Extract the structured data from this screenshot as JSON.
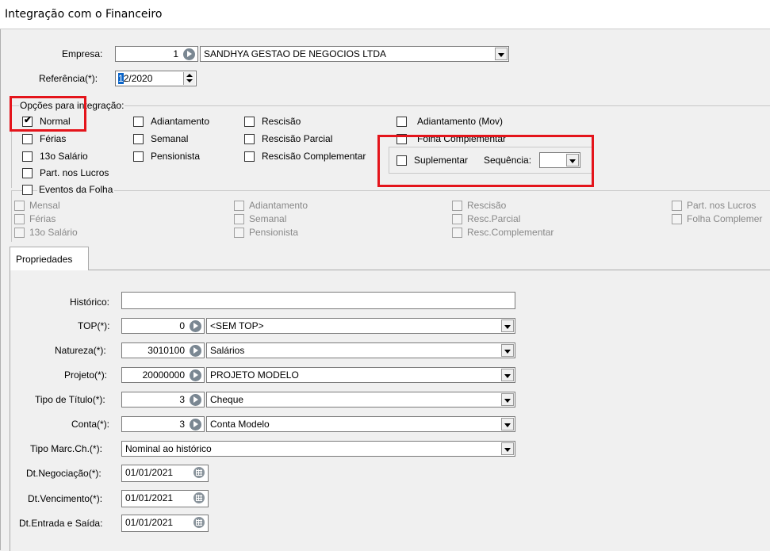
{
  "window": {
    "title": "Integração com o Financeiro"
  },
  "empresa": {
    "label": "Empresa:",
    "code": "1",
    "name": "SANDHYA GESTAO DE NEGOCIOS LTDA"
  },
  "referencia": {
    "label": "Referência(*):",
    "value_first": "1",
    "value_rest": "2/2020"
  },
  "opcoes": {
    "label": "Opções para integração:",
    "normal": {
      "label": "Normal",
      "checked": true
    },
    "ferias": "Férias",
    "salario13": "13o Salário",
    "lucros": "Part. nos Lucros",
    "adiantamento": "Adiantamento",
    "semanal": "Semanal",
    "pensionista": "Pensionista",
    "rescisao": "Rescisão",
    "rescisao_parcial": "Rescisão Parcial",
    "rescisao_complementar": "Rescisão Complementar",
    "adiantamento_mov": "Adiantamento (Mov)",
    "folha_complementar": "Folha Complementar",
    "suplementar": "Suplementar",
    "sequencia": "Sequência:"
  },
  "eventos": {
    "label": "Eventos da Folha",
    "mensal": "Mensal",
    "ferias": "Férias",
    "salario13": "13o Salário",
    "adiantamento": "Adiantamento",
    "semanal": "Semanal",
    "pensionista": "Pensionista",
    "rescisao": "Rescisão",
    "resc_parcial": "Resc.Parcial",
    "resc_complementar": "Resc.Complementar",
    "lucros": "Part. nos Lucros",
    "folha_complementar": "Folha Complemer"
  },
  "tabs": {
    "propriedades": "Propriedades"
  },
  "props": {
    "historico": {
      "label": "Histórico:",
      "value": ""
    },
    "top": {
      "label": "TOP(*):",
      "code": "0",
      "name": "<SEM TOP>"
    },
    "natureza": {
      "label": "Natureza(*):",
      "code": "3010100",
      "name": "Salários"
    },
    "projeto": {
      "label": "Projeto(*):",
      "code": "20000000",
      "name": "PROJETO MODELO"
    },
    "tipo_titulo": {
      "label": "Tipo de Título(*):",
      "code": "3",
      "name": "Cheque"
    },
    "conta": {
      "label": "Conta(*):",
      "code": "3",
      "name": "Conta Modelo"
    },
    "tipo_marc": {
      "label": "Tipo Marc.Ch.(*):",
      "value": "Nominal ao histórico"
    },
    "dt_negociacao": {
      "label": "Dt.Negociação(*):",
      "value": "01/01/2021"
    },
    "dt_vencimento": {
      "label": "Dt.Vencimento(*):",
      "value": "01/01/2021"
    },
    "dt_entrada": {
      "label": "Dt.Entrada e Saída:",
      "value": "01/01/2021"
    }
  },
  "colors": {
    "highlight": "#e4141b",
    "selection": "#0a64c8"
  }
}
